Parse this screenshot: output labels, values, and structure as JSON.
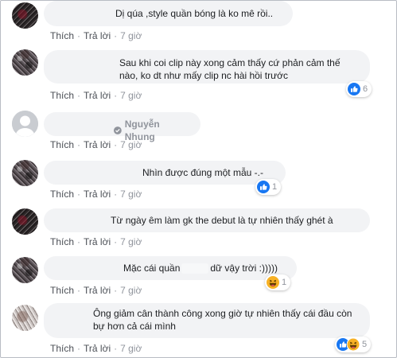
{
  "actions": {
    "like": "Thích",
    "reply": "Trả lời",
    "sep": "·"
  },
  "comments": [
    {
      "author": "",
      "text": "Dị qúa ,style quần bóng là ko mê rồi..",
      "time": "7 giờ"
    },
    {
      "author": "",
      "text": "Sau khi coi clip này xong cảm thấy cứ phản cảm thế nào, ko dt như mấy clip nc hài hồi trước",
      "time": "7 giờ",
      "reaction": {
        "icon": "like-reaction-icon",
        "count": "6"
      }
    },
    {
      "author": "Nguyễn Nhung",
      "text": "",
      "time": "7 giờ"
    },
    {
      "author": "",
      "text": "Nhìn được đúng một mẫu -.-",
      "time": "7 giờ",
      "reaction": {
        "icon": "like-reaction-icon",
        "count": "1"
      }
    },
    {
      "author": "",
      "text": "Từ ngày êm làm gk the debut là tự nhiên thấy ghét à",
      "time": "7 giờ"
    },
    {
      "author": "",
      "text_before": "Mặc cái quần",
      "text_after": "dữ vậy trời :)))))",
      "time": "7 giờ",
      "reaction": {
        "icon": "haha-reaction-icon",
        "count": "1"
      }
    },
    {
      "author": "",
      "text": "Ông giảm cân thành công xong giờ tự nhiên thấy cái đầu còn bự hơn cả cái mình",
      "time": "7 giờ",
      "reaction": {
        "icons": [
          "like-reaction-icon",
          "haha-reaction-icon"
        ],
        "count": "5"
      }
    }
  ],
  "colors": {
    "like_blue": "#1877f2",
    "haha_yellow": "#f7b125",
    "bubble": "#f2f3f5"
  }
}
